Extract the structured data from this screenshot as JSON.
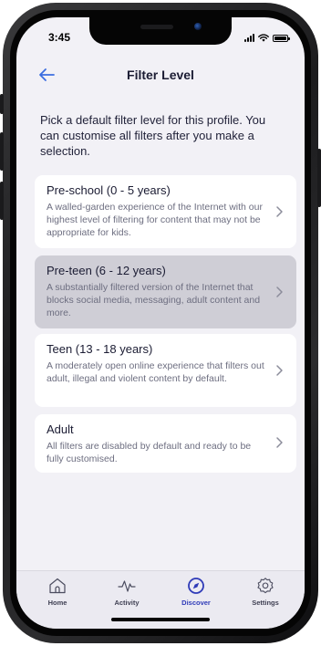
{
  "status": {
    "time": "3:45"
  },
  "header": {
    "title": "Filter Level"
  },
  "intro": {
    "text": "Pick a default filter level for this profile. You can customise all filters after you make a selection."
  },
  "levels": [
    {
      "title": "Pre-school (0 - 5 years)",
      "description": "A walled-garden experience of the Internet with our highest level of filtering for content that may not be appropriate for kids.",
      "selected": false
    },
    {
      "title": "Pre-teen (6 - 12 years)",
      "description": "A substantially filtered version of the Internet that blocks social media, messaging, adult content and more.",
      "selected": true
    },
    {
      "title": "Teen (13 - 18 years)",
      "description": "A moderately open online experience that filters out adult, illegal and violent content by default.",
      "selected": false
    },
    {
      "title": "Adult",
      "description": "All filters are disabled by default and ready to be fully customised.",
      "selected": false
    }
  ],
  "tabs": [
    {
      "label": "Home",
      "icon": "house-icon",
      "active": false
    },
    {
      "label": "Activity",
      "icon": "pulse-icon",
      "active": false
    },
    {
      "label": "Discover",
      "icon": "compass-icon",
      "active": true
    },
    {
      "label": "Settings",
      "icon": "gear-icon",
      "active": false
    }
  ],
  "colors": {
    "accent": "#2f3bb8",
    "back_arrow": "#3b6de0",
    "selected_card": "#cfced6",
    "screen_bg": "#f2f1f6"
  }
}
